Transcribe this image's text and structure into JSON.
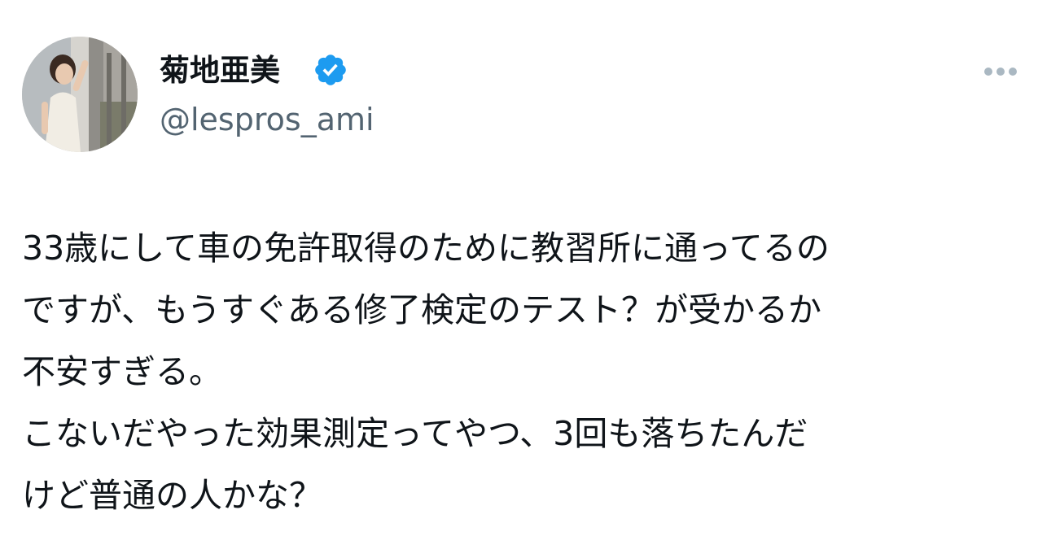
{
  "user": {
    "display_name": "菊地亜美",
    "handle": "@lespros_ami",
    "verified": true,
    "verified_icon": "verified-badge-icon",
    "avatar_icon": "profile-photo-avatar"
  },
  "menu": {
    "icon": "more-options-icon"
  },
  "tweet": {
    "lines": [
      "33歳にして車の免許取得のために教習所に通ってるの",
      "ですが、もうすぐある修了検定のテスト？が受かるか",
      "不安すぎる。",
      "こないだやった効果測定ってやつ、3回も落ちたんだ",
      "けど普通の人かな？"
    ]
  },
  "colors": {
    "text": "#0f1419",
    "secondary_text": "#536471",
    "verified_blue": "#1d9bf0",
    "more_dots": "#aab8c2"
  }
}
